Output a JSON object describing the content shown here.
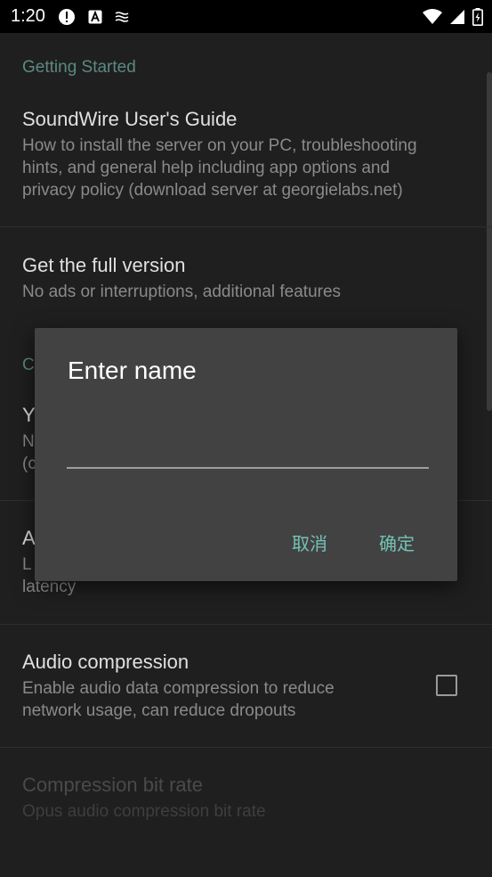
{
  "status_bar": {
    "time": "1:20",
    "icons_left": [
      "alert-icon",
      "a-icon",
      "cast-icon"
    ],
    "icons_right": [
      "wifi-icon",
      "signal-icon",
      "battery-icon"
    ]
  },
  "settings": {
    "category_getting_started": "Getting Started",
    "guide": {
      "title": "SoundWire User's Guide",
      "summary_line1": "How to install the server on your PC, troubleshooting",
      "summary_line2": "hints, and general help including app options and",
      "summary_line3": "privacy policy (download server at georgielabs.net)"
    },
    "full_version": {
      "title": "Get the full version",
      "summary": "No ads or interruptions, additional features"
    },
    "partial_category_letter": "C",
    "partial_item": {
      "title_letter": "Y",
      "summary_letter1": "N",
      "summary_letter2": "(c"
    },
    "partial_item2": {
      "title_letter": "A",
      "summary_letter": "L",
      "summary_tail": "latency"
    },
    "audio_compression": {
      "title": "Audio compression",
      "summary_line1": "Enable audio data compression to reduce",
      "summary_line2": "network usage, can reduce dropouts",
      "checked": false
    },
    "bit_rate": {
      "title": "Compression bit rate",
      "summary": "Opus audio compression bit rate",
      "enabled": false
    }
  },
  "dialog": {
    "title": "Enter name",
    "input_value": "",
    "cancel_label": "取消",
    "ok_label": "确定",
    "accent_color": "#74c2b6"
  }
}
